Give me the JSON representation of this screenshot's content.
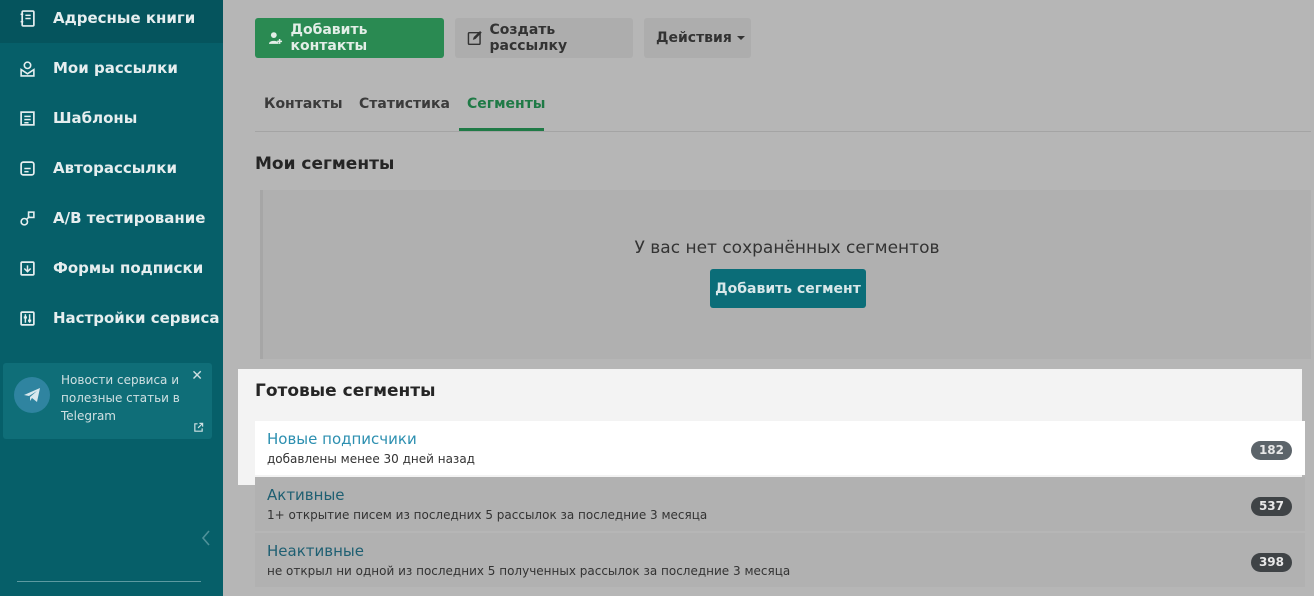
{
  "sidebar": {
    "items": [
      {
        "label": "Адресные книги",
        "icon": "address-book-icon"
      },
      {
        "label": "Мои рассылки",
        "icon": "mailings-icon"
      },
      {
        "label": "Шаблоны",
        "icon": "templates-icon"
      },
      {
        "label": "Авторассылки",
        "icon": "autoresponder-icon"
      },
      {
        "label": "A/B тестирование",
        "icon": "ab-test-icon"
      },
      {
        "label": "Формы подписки",
        "icon": "subscription-form-icon"
      },
      {
        "label": "Настройки сервиса",
        "icon": "settings-icon"
      }
    ],
    "telegram": {
      "text": "Новости сервиса и полезные статьи в Telegram"
    }
  },
  "toolbar": {
    "add_contacts": "Добавить контакты",
    "create_mailing": "Создать рассылку",
    "actions": "Действия"
  },
  "tabs": [
    "Контакты",
    "Статистика",
    "Сегменты"
  ],
  "my_segments": {
    "title": "Мои сегменты",
    "empty_text": "У вас нет сохранённых сегментов",
    "add_button": "Добавить сегмент"
  },
  "ready_segments": {
    "title": "Готовые сегменты",
    "items": [
      {
        "name": "Новые подписчики",
        "desc": "добавлены менее 30 дней назад",
        "count": "182"
      },
      {
        "name": "Активные",
        "desc": "1+ открытие писем из последних 5 рассылок за последние 3 месяца",
        "count": "537"
      },
      {
        "name": "Неактивные",
        "desc": "не открыл ни одной из последних 5 полученных рассылок за последние 3 месяца",
        "count": "398"
      }
    ]
  },
  "colors": {
    "sidebar": "#065f69",
    "primary_green": "#2a8a52",
    "teal_button": "#0b6d78"
  }
}
